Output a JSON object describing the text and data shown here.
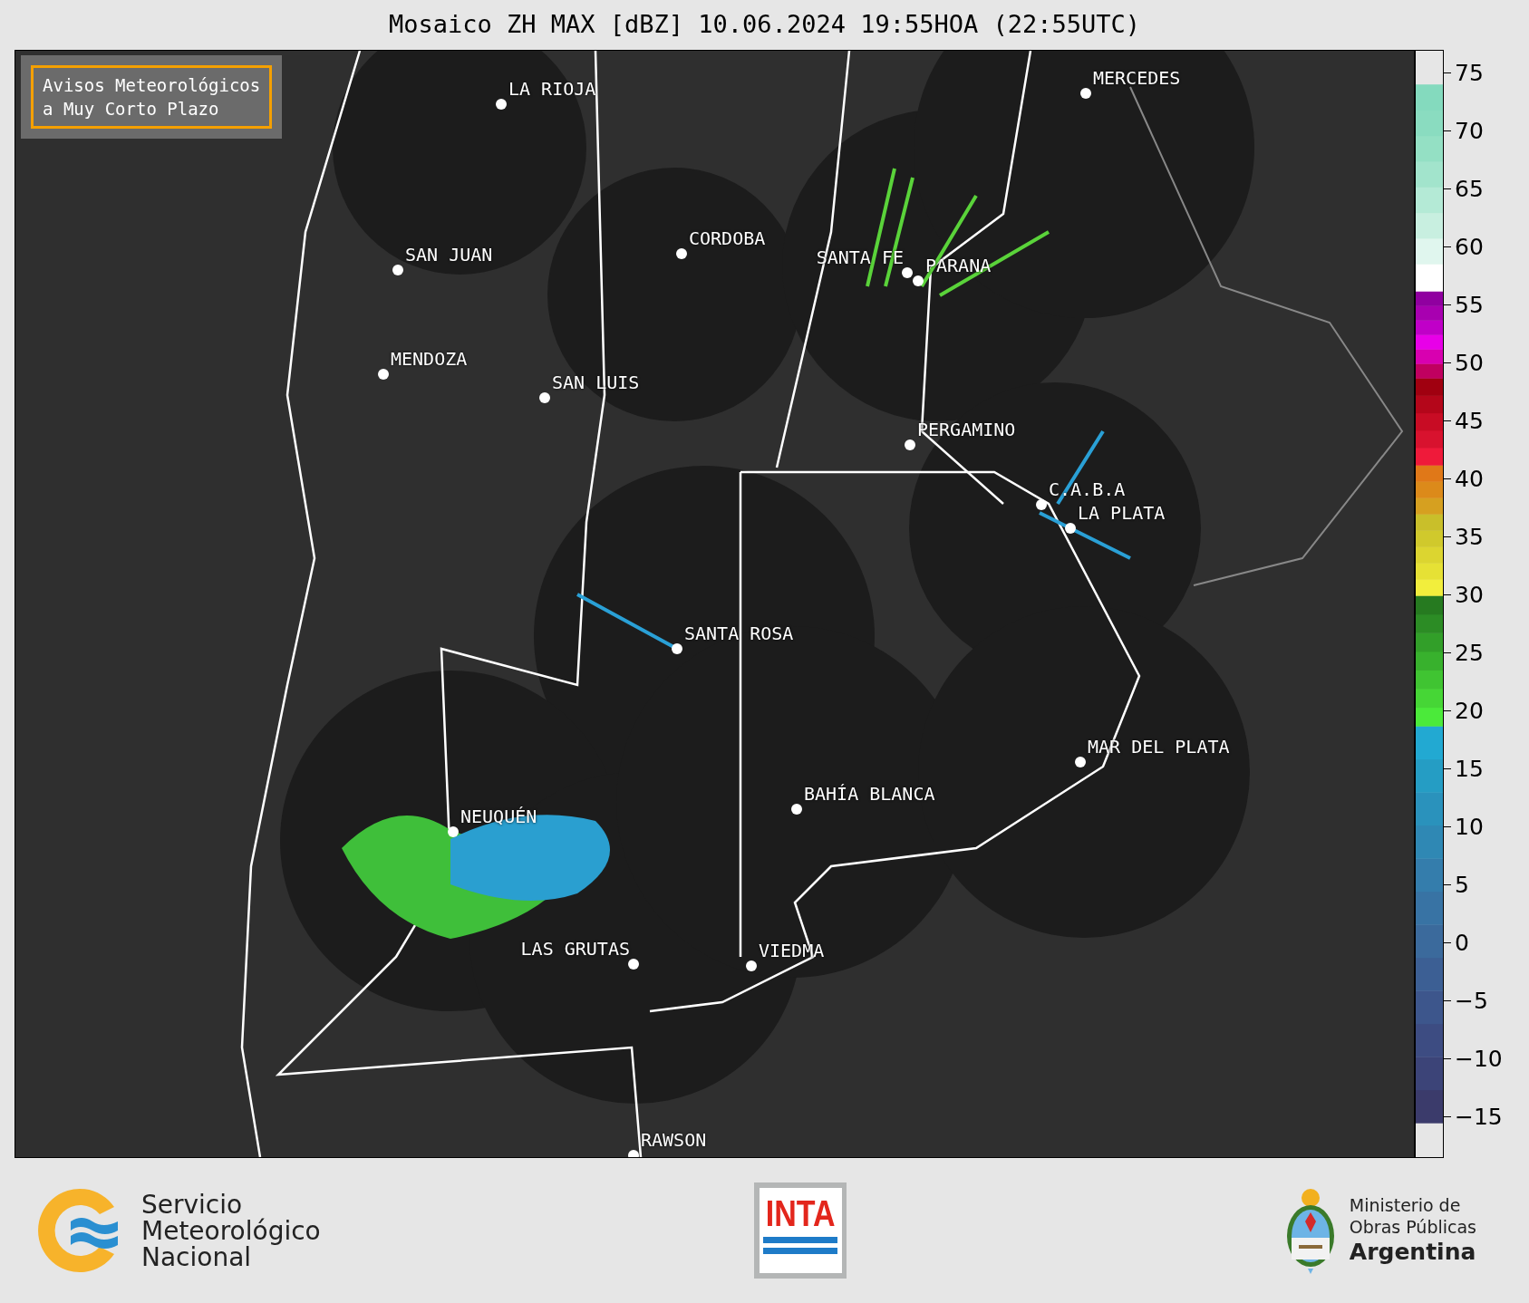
{
  "title": "Mosaico ZH MAX [dBZ] 10.06.2024 19:55HOA (22:55UTC)",
  "notice": {
    "lines": [
      "Avisos Meteorológicos",
      "a Muy Corto Plazo"
    ]
  },
  "cities": [
    {
      "name": "LA RIOJA"
    },
    {
      "name": "MERCEDES"
    },
    {
      "name": "CORDOBA"
    },
    {
      "name": "SAN JUAN"
    },
    {
      "name": "SANTA FE"
    },
    {
      "name": "PARANA"
    },
    {
      "name": "MENDOZA"
    },
    {
      "name": "SAN LUIS"
    },
    {
      "name": "PERGAMINO"
    },
    {
      "name": "C.A.B.A"
    },
    {
      "name": "LA PLATA"
    },
    {
      "name": "SANTA ROSA"
    },
    {
      "name": "MAR DEL PLATA"
    },
    {
      "name": "BAHÍA BLANCA"
    },
    {
      "name": "NEUQUÉN"
    },
    {
      "name": "LAS GRUTAS"
    },
    {
      "name": "VIEDMA"
    },
    {
      "name": "RAWSON"
    }
  ],
  "colorbar": {
    "ticks": [
      "75",
      "70",
      "65",
      "60",
      "55",
      "50",
      "45",
      "40",
      "35",
      "30",
      "25",
      "20",
      "15",
      "10",
      "5",
      "0",
      "−5",
      "−10",
      "−15"
    ]
  },
  "footer": {
    "smn_lines": [
      "Servicio",
      "Meteorológico",
      "Nacional"
    ],
    "inta": "INTA",
    "ministry_lines": [
      "Ministerio de",
      "Obras Públicas",
      "Argentina"
    ]
  }
}
